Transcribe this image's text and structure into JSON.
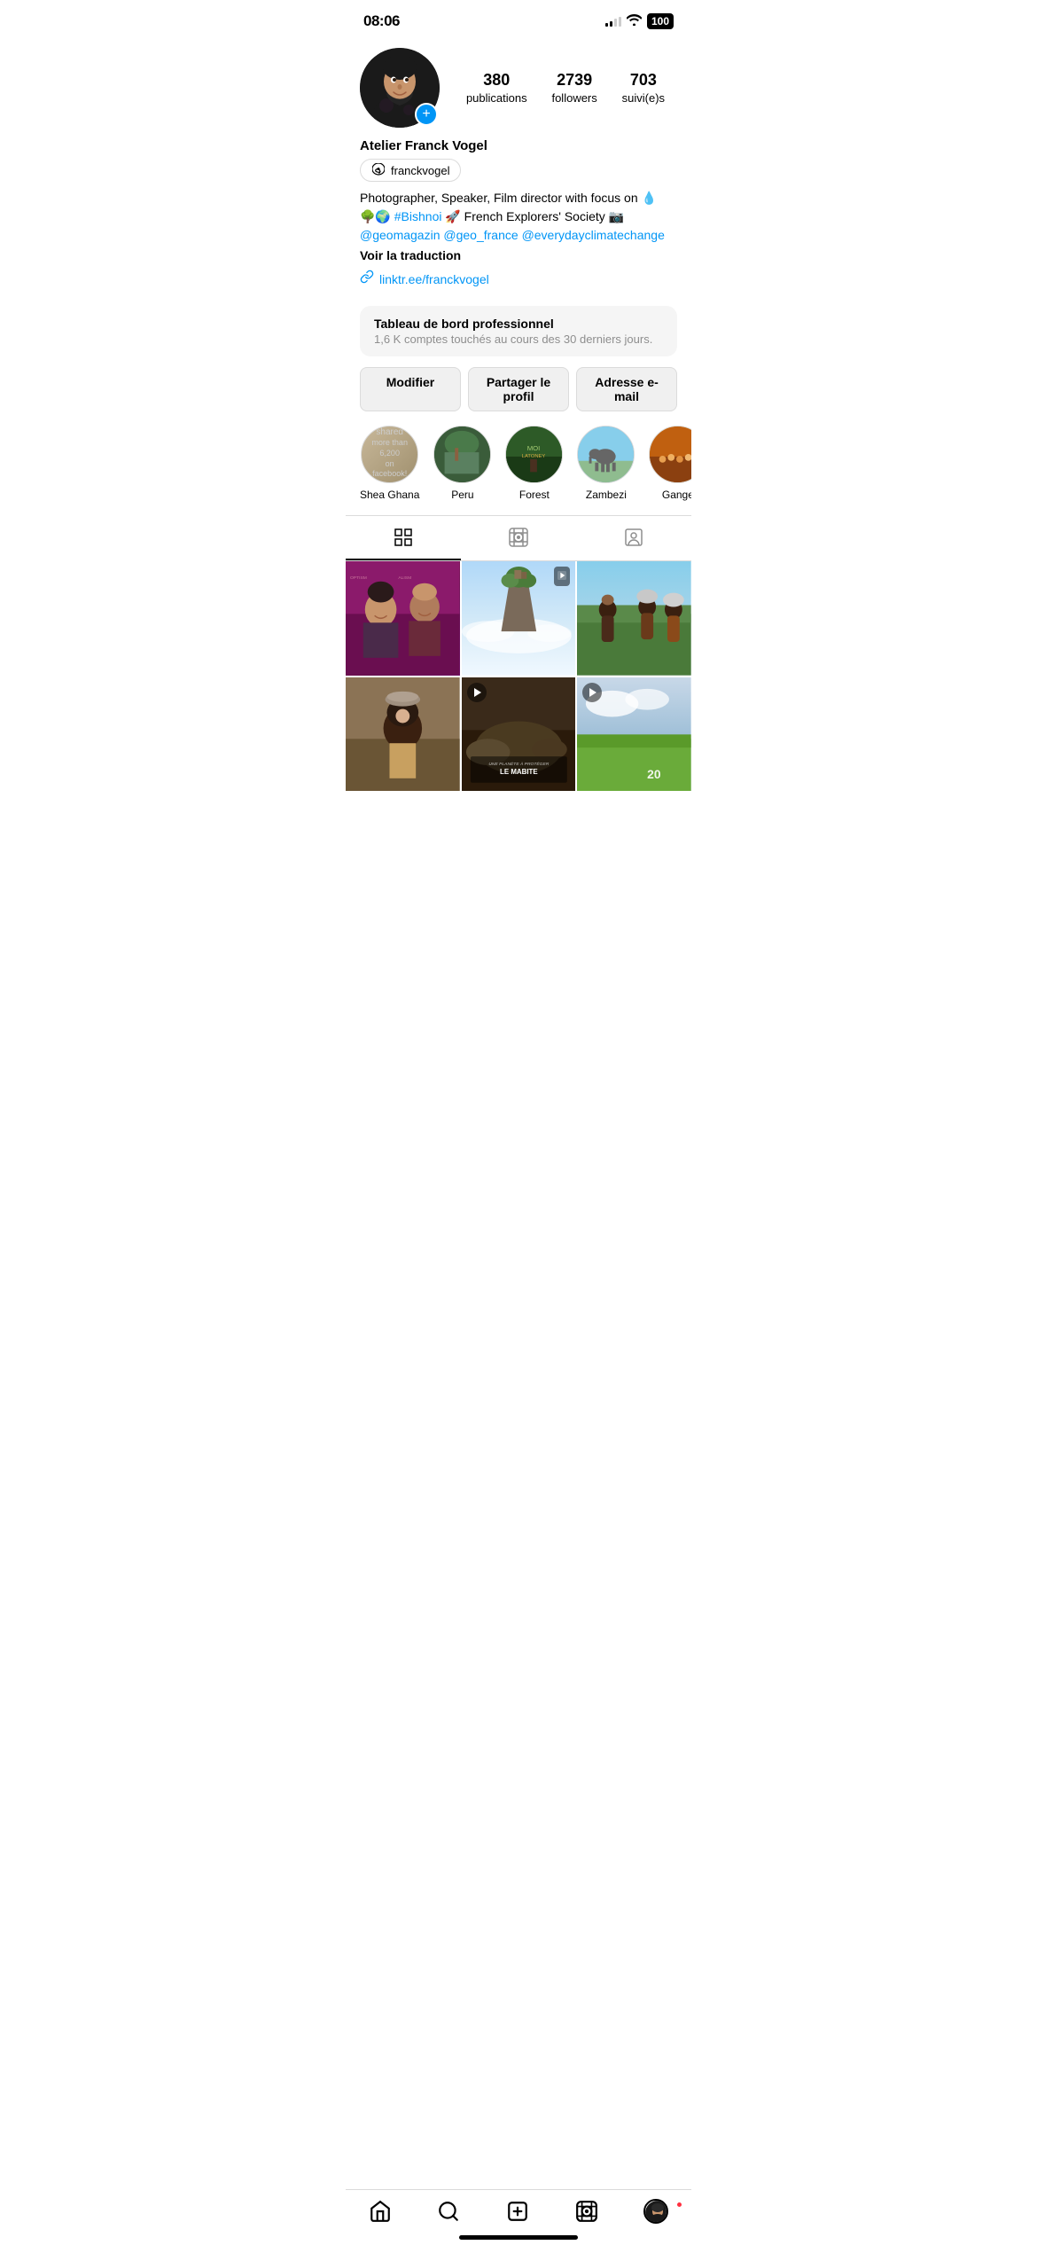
{
  "statusBar": {
    "time": "08:06",
    "batteryLevel": "100",
    "signalBars": [
      3,
      5,
      7,
      9
    ],
    "wifiIcon": "wifi"
  },
  "profile": {
    "stats": {
      "publications": {
        "count": "380",
        "label": "publications"
      },
      "followers": {
        "count": "2739",
        "label": "followers"
      },
      "following": {
        "count": "703",
        "label": "suivi(e)s"
      }
    },
    "name": "Atelier Franck Vogel",
    "threadsUsername": "franckvogel",
    "bio": "Photographer, Speaker, Film director with focus on 💧🌳🌍 #Bishnoi 🚀 French Explorers' Society 📷",
    "bioLinks": "@geomagazin @geo_france @everydayclimatechange",
    "translation": "Voir la traduction",
    "link": "linktr.ee/franckvogel"
  },
  "dashboard": {
    "title": "Tableau de bord professionnel",
    "subtitle": "1,6 K comptes touchés au cours des 30 derniers jours."
  },
  "actionButtons": {
    "modifier": "Modifier",
    "share": "Partager le profil",
    "email": "Adresse e-mail"
  },
  "highlights": [
    {
      "label": "Shea Ghana",
      "emoji": "📜"
    },
    {
      "label": "Peru",
      "emoji": "🌿"
    },
    {
      "label": "Forest",
      "emoji": "🌲"
    },
    {
      "label": "Zambezi",
      "emoji": "🐘"
    },
    {
      "label": "Gange",
      "emoji": "🎉"
    }
  ],
  "contentTabs": [
    {
      "id": "grid",
      "icon": "⊞",
      "active": true
    },
    {
      "id": "reels",
      "icon": "▶",
      "active": false
    },
    {
      "id": "tagged",
      "icon": "◫",
      "active": false
    }
  ],
  "bottomNav": [
    {
      "id": "home",
      "icon": "🏠"
    },
    {
      "id": "search",
      "icon": "🔍"
    },
    {
      "id": "add",
      "icon": "➕"
    },
    {
      "id": "reels",
      "icon": "▶"
    },
    {
      "id": "profile",
      "icon": "👤"
    }
  ],
  "photos": [
    {
      "id": 1,
      "type": "image",
      "hasVideo": false
    },
    {
      "id": 2,
      "type": "image",
      "hasVideo": false
    },
    {
      "id": 3,
      "type": "image",
      "hasVideo": false
    },
    {
      "id": 4,
      "type": "image",
      "hasVideo": false
    },
    {
      "id": 5,
      "type": "video",
      "hasVideo": true
    },
    {
      "id": 6,
      "type": "video",
      "hasVideo": true
    }
  ]
}
